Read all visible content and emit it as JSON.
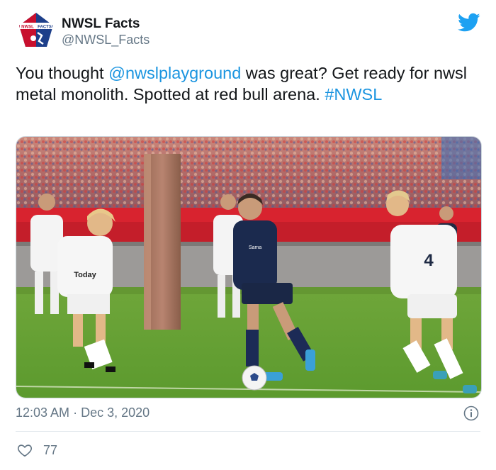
{
  "account": {
    "name": "NWSL Facts",
    "handle": "@NWSL_Facts",
    "logo_text_left": "NWSL",
    "logo_text_right": "FACTS"
  },
  "tweet": {
    "text_1": "You thought ",
    "mention": "@nwslplayground",
    "text_2": " was great? Get ready for nwsl metal monolith. Spotted at red bull arena. ",
    "hashtag": "#NWSL",
    "time": "12:03 AM",
    "separator": "·",
    "date": "Dec 3, 2020",
    "likes": "77"
  },
  "photo": {
    "jersey_number": "4",
    "shirt_sponsor": "Today",
    "shirt_sponsor_2": "Sama"
  },
  "colors": {
    "link": "#1b95e0",
    "twitter_blue": "#1da1f2",
    "secondary_text": "#657786",
    "logo_red": "#c8102e",
    "logo_blue": "#1d3f8a"
  },
  "icons": [
    "twitter-bird-icon",
    "info-icon",
    "heart-icon"
  ]
}
